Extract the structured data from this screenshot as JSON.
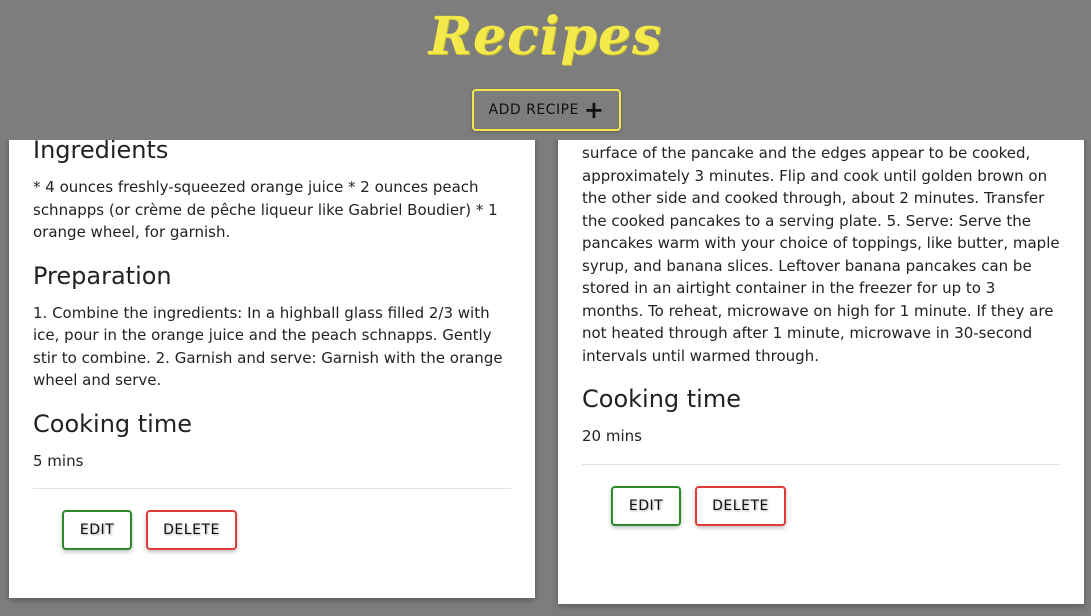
{
  "header": {
    "title": "Recipes",
    "add_button_label": "ADD RECIPE",
    "add_button_icon": "plus-icon"
  },
  "colors": {
    "background": "#7d7d7d",
    "title": "#f4e94b",
    "add_border": "#f1e64a",
    "edit_border": "#2a8a2a",
    "delete_border": "#e03a3a"
  },
  "cards": [
    {
      "ingredients_heading": "Ingredients",
      "ingredients_text": "* 4 ounces freshly-squeezed orange juice * 2 ounces peach schnapps (or crème de pêche liqueur like Gabriel Boudier) * 1 orange wheel, for garnish.",
      "preparation_heading": "Preparation",
      "preparation_text": "1. Combine the ingredients: In a highball glass filled 2/3 with ice, pour in the orange juice and the peach schnapps. Gently stir to combine. 2. Garnish and serve: Garnish with the orange wheel and serve.",
      "cooking_heading": "Cooking time",
      "cooking_time": "5 mins",
      "edit_label": "EDIT",
      "delete_label": "DELETE"
    },
    {
      "preparation_text": "pancakes, without their edges touching, depending on the size of your pan or griddle. Cook until you see bubbles come to the surface of the pancake and the edges appear to be cooked, approximately 3 minutes. Flip and cook until golden brown on the other side and cooked through, about 2 minutes. Transfer the cooked pancakes to a serving plate. 5. Serve: Serve the pancakes warm with your choice of toppings, like butter, maple syrup, and banana slices. Leftover banana pancakes can be stored in an airtight container in the freezer for up to 3 months. To reheat, microwave on high for 1 minute. If they are not heated through after 1 minute, microwave in 30-second intervals until warmed through.",
      "cooking_heading": "Cooking time",
      "cooking_time": "20 mins",
      "edit_label": "EDIT",
      "delete_label": "DELETE"
    }
  ]
}
